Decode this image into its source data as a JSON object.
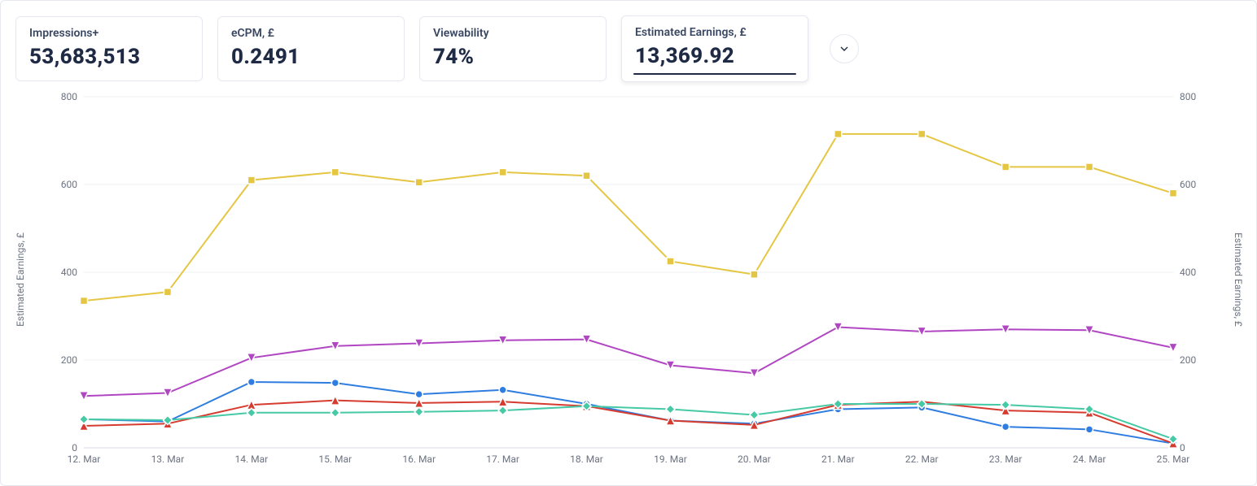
{
  "cards": [
    {
      "label": "Impressions+",
      "value": "53,683,513",
      "active": false
    },
    {
      "label": "eCPM, £",
      "value": "0.2491",
      "active": false
    },
    {
      "label": "Viewability",
      "value": "74%",
      "active": false
    },
    {
      "label": "Estimated Earnings, £",
      "value": "13,369.92",
      "active": true
    }
  ],
  "chart_data": {
    "type": "line",
    "xlabel": "",
    "ylabel_left": "Estimated Earnings, £",
    "ylabel_right": "Estimated Earnings, £",
    "ylim": [
      0,
      800
    ],
    "yticks": [
      0,
      200,
      400,
      600,
      800
    ],
    "categories": [
      "12. Mar",
      "13. Mar",
      "14. Mar",
      "15. Mar",
      "16. Mar",
      "17. Mar",
      "18. Mar",
      "19. Mar",
      "20. Mar",
      "21. Mar",
      "22. Mar",
      "23. Mar",
      "24. Mar",
      "25. Mar"
    ],
    "series": [
      {
        "name": "yellow",
        "color": "#e5c643",
        "marker": "square",
        "values": [
          335,
          355,
          610,
          628,
          605,
          628,
          620,
          425,
          395,
          715,
          715,
          640,
          640,
          580
        ]
      },
      {
        "name": "purple",
        "color": "#b146c2",
        "marker": "triangle-down",
        "values": [
          118,
          125,
          205,
          232,
          238,
          245,
          247,
          188,
          170,
          275,
          265,
          270,
          268,
          228
        ]
      },
      {
        "name": "blue",
        "color": "#2f7de1",
        "marker": "circle",
        "values": [
          65,
          60,
          150,
          148,
          122,
          132,
          100,
          62,
          55,
          88,
          92,
          48,
          42,
          10
        ]
      },
      {
        "name": "red",
        "color": "#d63b2f",
        "marker": "triangle-up",
        "values": [
          50,
          55,
          98,
          108,
          102,
          105,
          95,
          62,
          52,
          98,
          105,
          85,
          80,
          10
        ]
      },
      {
        "name": "teal",
        "color": "#46c9a5",
        "marker": "diamond",
        "values": [
          65,
          63,
          80,
          80,
          82,
          85,
          95,
          88,
          75,
          100,
          100,
          98,
          88,
          20
        ]
      }
    ]
  }
}
